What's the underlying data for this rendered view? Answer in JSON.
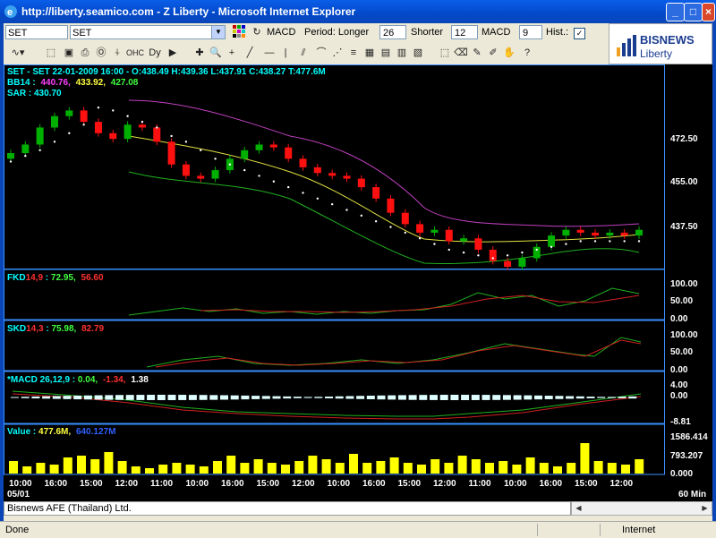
{
  "window": {
    "title": "http://liberty.seamico.com - Z Liberty - Microsoft Internet Explorer"
  },
  "toolbar": {
    "symbol_value": "SET",
    "symbol_combo_value": "SET",
    "indicator_label": "MACD",
    "period_label": "Period: Longer",
    "longer_value": "26",
    "shorter_label": "Shorter",
    "shorter_value": "12",
    "macd_label": "MACD",
    "macd_value": "9",
    "hist_label": "Hist.:",
    "hist_checked": "✓"
  },
  "logo": {
    "line1": "BISNEWS",
    "line2": "Liberty"
  },
  "colors": {
    "bg": "#000000",
    "up": "#00b000",
    "down": "#ff1010",
    "bb_upper": "#c040c0",
    "bb_mid": "#e0e040",
    "bb_lower": "#20b020",
    "axis": "#00c0ff",
    "volume": "#ffff00"
  },
  "info": {
    "ohlc_line": "SET - SET 22-01-2009 16:00 - O:438.49 H:439.36 L:437.91 C:438.27 T:477.6M",
    "bb_label": "BB14 :",
    "bb_upper": "440.76,",
    "bb_mid": "433.92,",
    "bb_lower": "427.08",
    "sar_line": "SAR : 430.70",
    "fkd_label": "FKD",
    "fkd_param": "14,9",
    "fkd_sep": " : ",
    "fkd_v1": "72.95,",
    "fkd_v2": "56.60",
    "skd_label": "SKD",
    "skd_param": "14,3",
    "skd_sep": " : ",
    "skd_v1": "75.98,",
    "skd_v2": "82.79",
    "macd_label": "*MACD 26,12,9 : ",
    "macd_v1": "0.04,",
    "macd_v2": "-1.34,",
    "macd_v3": "1.38",
    "vol_label": "Value : ",
    "vol_v1": "477.6M,",
    "vol_v2": "640.127M"
  },
  "axes": {
    "price": [
      "472.50",
      "455.00",
      "437.50"
    ],
    "fkd": [
      "100.00",
      "50.00",
      "0.00"
    ],
    "skd": [
      "100.00",
      "50.00",
      "0.00"
    ],
    "macd": [
      "4.00",
      "0.00",
      "-8.81"
    ],
    "vol": [
      "1586.414",
      "793.207",
      "0.000"
    ],
    "time_labels": [
      "10:00",
      "16:00",
      "15:00",
      "12:00",
      "11:00",
      "10:00",
      "16:00",
      "15:00",
      "12:00",
      "10:00",
      "16:00",
      "15:00",
      "12:00",
      "11:00",
      "10:00",
      "16:00",
      "15:00",
      "12:00"
    ],
    "date_label": "05/01",
    "interval_label": "60 Min"
  },
  "chart_data": {
    "type": "candlestick",
    "price_ylim": [
      425,
      488
    ],
    "bars": 44,
    "close": [
      465,
      468,
      474,
      478,
      480,
      476,
      472,
      470,
      475,
      474,
      469,
      461,
      457,
      456,
      459,
      463,
      466,
      468,
      467,
      463,
      460,
      458,
      457,
      456,
      453,
      449,
      444,
      440,
      437,
      438,
      434,
      435,
      431,
      427,
      425,
      428,
      432,
      436,
      438,
      437,
      436,
      437,
      436,
      438
    ],
    "sar": [
      462,
      464,
      466,
      469,
      472,
      475,
      481,
      480,
      478,
      476,
      474,
      471,
      469,
      466,
      463,
      461,
      459,
      457,
      455,
      453,
      451,
      449,
      447,
      445,
      443,
      441,
      439,
      437,
      435,
      433,
      431,
      430,
      429,
      428,
      429,
      430,
      431,
      432,
      433,
      434,
      434,
      434,
      434,
      434
    ],
    "fkd_k": [
      0,
      0,
      0,
      0,
      0,
      0,
      0,
      0,
      0,
      0,
      20,
      25,
      30,
      35,
      40,
      30,
      38,
      25,
      20,
      15,
      18,
      20,
      15,
      12,
      10,
      8,
      15,
      20,
      40,
      55,
      70,
      60,
      75,
      65,
      60,
      50,
      70,
      65,
      40,
      45,
      35,
      20,
      60,
      85
    ],
    "fkd_d": [
      0,
      0,
      0,
      0,
      0,
      0,
      0,
      0,
      0,
      0,
      20,
      22,
      25,
      28,
      30,
      30,
      32,
      30,
      28,
      25,
      23,
      22,
      20,
      18,
      16,
      14,
      14,
      16,
      22,
      30,
      40,
      45,
      52,
      56,
      58,
      56,
      60,
      62,
      56,
      52,
      48,
      42,
      48,
      55
    ],
    "volume": [
      35,
      20,
      30,
      25,
      45,
      50,
      40,
      60,
      35,
      20,
      15,
      25,
      30,
      25,
      20,
      35,
      50,
      30,
      40,
      30,
      25,
      35,
      50,
      40,
      30,
      55,
      30,
      35,
      45,
      30,
      25,
      40,
      30,
      50,
      40,
      30,
      35,
      25,
      45,
      30,
      20,
      30,
      85,
      35,
      30,
      25,
      40
    ]
  },
  "footer": {
    "status_text": "Bisnews AFE (Thailand) Ltd.",
    "ie_status": "Done",
    "ie_zone": "Internet"
  }
}
